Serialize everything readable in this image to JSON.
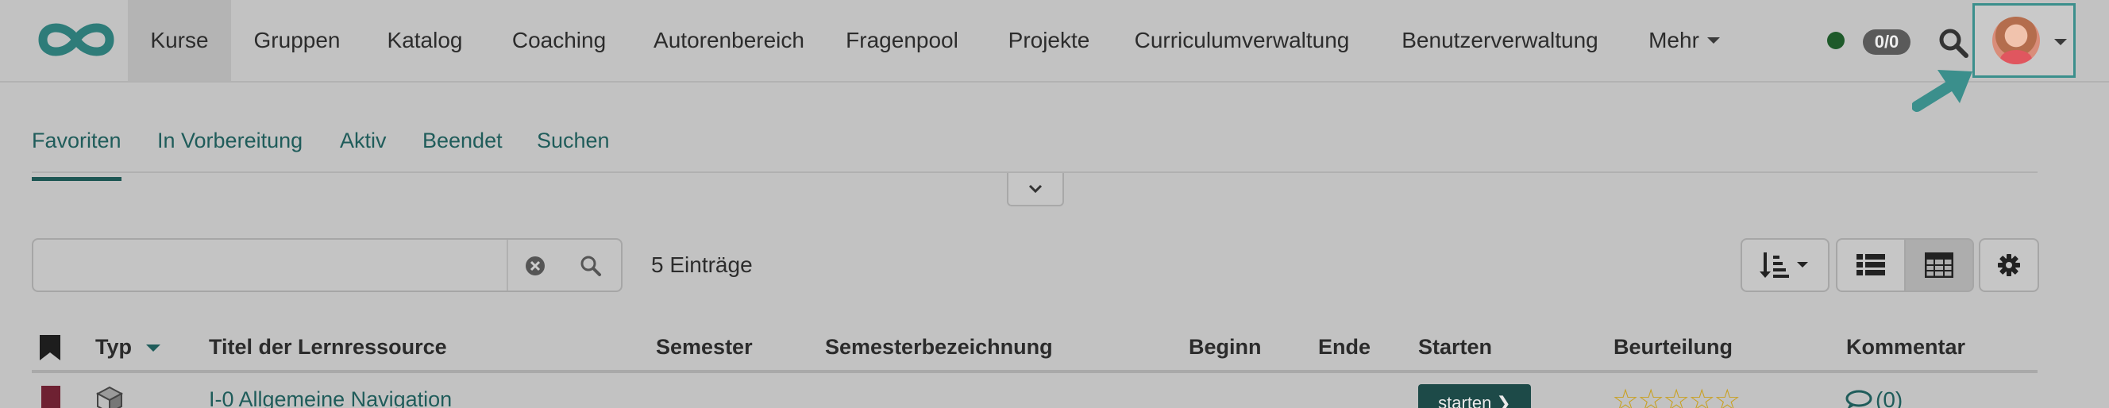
{
  "nav": {
    "items": [
      {
        "label": "Kurse",
        "active": true
      },
      {
        "label": "Gruppen"
      },
      {
        "label": "Katalog"
      },
      {
        "label": "Coaching"
      },
      {
        "label": "Autorenbereich"
      },
      {
        "label": "Fragenpool"
      },
      {
        "label": "Projekte"
      },
      {
        "label": "Curriculumverwaltung"
      },
      {
        "label": "Benutzerverwaltung"
      },
      {
        "label": "Mehr"
      }
    ],
    "counter": "0/0",
    "status_color": "#1e5a2a",
    "icons": [
      "infinity-logo",
      "search-icon",
      "avatar",
      "chevron-down-icon"
    ]
  },
  "tabs": [
    {
      "label": "Favoriten",
      "active": true
    },
    {
      "label": "In Vorbereitung"
    },
    {
      "label": "Aktiv"
    },
    {
      "label": "Beendet"
    },
    {
      "label": "Suchen"
    }
  ],
  "search": {
    "value": "",
    "placeholder": ""
  },
  "entries_label": "5 Einträge",
  "table": {
    "headers": {
      "type": "Typ",
      "title": "Titel der Lernressource",
      "semester": "Semester",
      "semester_name": "Semesterbezeichnung",
      "begin": "Beginn",
      "end": "Ende",
      "start": "Starten",
      "rating": "Beurteilung",
      "comment": "Kommentar"
    },
    "rows": [
      {
        "title": "I-0 Allgemeine Navigation",
        "start_label": "starten",
        "rating": "☆☆☆☆☆",
        "comments": "(0)"
      }
    ]
  },
  "colors": {
    "accent": "#1f5c5a",
    "highlight": "#3b8f8c",
    "bookmark": "#6e2132"
  }
}
